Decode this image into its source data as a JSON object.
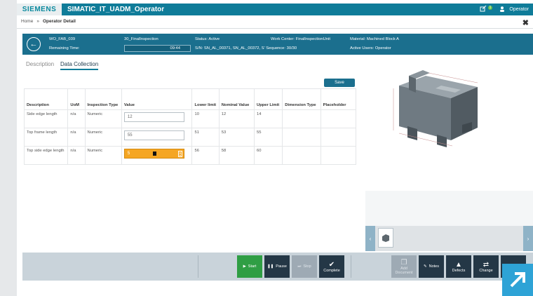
{
  "topbar": {
    "logo": "SIEMENS",
    "app_title": "SIMATIC_IT_UADM_Operator",
    "badge": "1",
    "user": "Operator"
  },
  "breadcrumb": {
    "home": "Home",
    "sep": "»",
    "current": "Operator Detail"
  },
  "order": {
    "work_order": "WO_FAB_039",
    "operation": "30_FinalInspection",
    "remaining_label": "Remaining Time:",
    "remaining_value": "09:44",
    "status": "Status: Active",
    "work_center": "Work Center: FinalInspectionUnit",
    "serials": "S/N: SN_AL_00371, SN_AL_00372, S’ Sequence: 30/30",
    "material": "Material: Machined Block A",
    "active_users": "Active Users: Operator"
  },
  "tabs": [
    {
      "label": "Description"
    },
    {
      "label": "Data Collection"
    }
  ],
  "save_label": "Save",
  "table": {
    "headers": [
      "Description",
      "UoM",
      "Inspection Type",
      "Value",
      "Lower limit",
      "Nominal Value",
      "Upper Limit",
      "Dimension Type",
      "Placeholder"
    ],
    "rows": [
      {
        "description": "Side edge length",
        "uom": "n/a",
        "type": "Numeric",
        "value": "12",
        "lower": "10",
        "nominal": "12",
        "upper": "14"
      },
      {
        "description": "Top frame length",
        "uom": "n/a",
        "type": "Numeric",
        "value": "55",
        "lower": "51",
        "nominal": "53",
        "upper": "55"
      },
      {
        "description": "Top side edge length",
        "uom": "n/a",
        "type": "Numeric",
        "value": "5",
        "lower": "56",
        "nominal": "58",
        "upper": "60"
      }
    ]
  },
  "toolbar": {
    "start": "Start",
    "pause": "Pause",
    "stop": "Stop",
    "complete": "Complete",
    "add_document": "Add Document",
    "notes": "Notes",
    "defects": "Defects",
    "change": "Change"
  }
}
